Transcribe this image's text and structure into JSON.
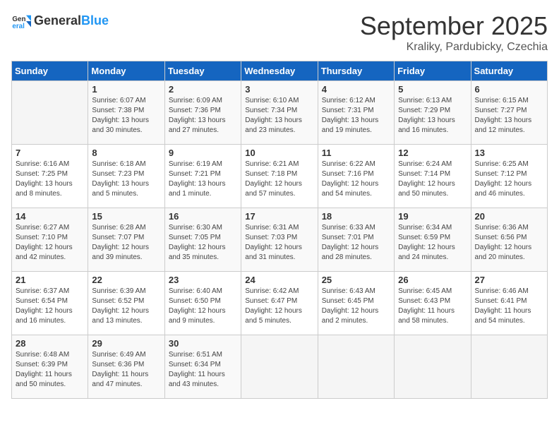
{
  "header": {
    "logo_general": "General",
    "logo_blue": "Blue",
    "month_title": "September 2025",
    "subtitle": "Kraliky, Pardubicky, Czechia"
  },
  "calendar": {
    "days_of_week": [
      "Sunday",
      "Monday",
      "Tuesday",
      "Wednesday",
      "Thursday",
      "Friday",
      "Saturday"
    ],
    "weeks": [
      [
        {
          "day": "",
          "info": ""
        },
        {
          "day": "1",
          "info": "Sunrise: 6:07 AM\nSunset: 7:38 PM\nDaylight: 13 hours\nand 30 minutes."
        },
        {
          "day": "2",
          "info": "Sunrise: 6:09 AM\nSunset: 7:36 PM\nDaylight: 13 hours\nand 27 minutes."
        },
        {
          "day": "3",
          "info": "Sunrise: 6:10 AM\nSunset: 7:34 PM\nDaylight: 13 hours\nand 23 minutes."
        },
        {
          "day": "4",
          "info": "Sunrise: 6:12 AM\nSunset: 7:31 PM\nDaylight: 13 hours\nand 19 minutes."
        },
        {
          "day": "5",
          "info": "Sunrise: 6:13 AM\nSunset: 7:29 PM\nDaylight: 13 hours\nand 16 minutes."
        },
        {
          "day": "6",
          "info": "Sunrise: 6:15 AM\nSunset: 7:27 PM\nDaylight: 13 hours\nand 12 minutes."
        }
      ],
      [
        {
          "day": "7",
          "info": "Sunrise: 6:16 AM\nSunset: 7:25 PM\nDaylight: 13 hours\nand 8 minutes."
        },
        {
          "day": "8",
          "info": "Sunrise: 6:18 AM\nSunset: 7:23 PM\nDaylight: 13 hours\nand 5 minutes."
        },
        {
          "day": "9",
          "info": "Sunrise: 6:19 AM\nSunset: 7:21 PM\nDaylight: 13 hours\nand 1 minute."
        },
        {
          "day": "10",
          "info": "Sunrise: 6:21 AM\nSunset: 7:18 PM\nDaylight: 12 hours\nand 57 minutes."
        },
        {
          "day": "11",
          "info": "Sunrise: 6:22 AM\nSunset: 7:16 PM\nDaylight: 12 hours\nand 54 minutes."
        },
        {
          "day": "12",
          "info": "Sunrise: 6:24 AM\nSunset: 7:14 PM\nDaylight: 12 hours\nand 50 minutes."
        },
        {
          "day": "13",
          "info": "Sunrise: 6:25 AM\nSunset: 7:12 PM\nDaylight: 12 hours\nand 46 minutes."
        }
      ],
      [
        {
          "day": "14",
          "info": "Sunrise: 6:27 AM\nSunset: 7:10 PM\nDaylight: 12 hours\nand 42 minutes."
        },
        {
          "day": "15",
          "info": "Sunrise: 6:28 AM\nSunset: 7:07 PM\nDaylight: 12 hours\nand 39 minutes."
        },
        {
          "day": "16",
          "info": "Sunrise: 6:30 AM\nSunset: 7:05 PM\nDaylight: 12 hours\nand 35 minutes."
        },
        {
          "day": "17",
          "info": "Sunrise: 6:31 AM\nSunset: 7:03 PM\nDaylight: 12 hours\nand 31 minutes."
        },
        {
          "day": "18",
          "info": "Sunrise: 6:33 AM\nSunset: 7:01 PM\nDaylight: 12 hours\nand 28 minutes."
        },
        {
          "day": "19",
          "info": "Sunrise: 6:34 AM\nSunset: 6:59 PM\nDaylight: 12 hours\nand 24 minutes."
        },
        {
          "day": "20",
          "info": "Sunrise: 6:36 AM\nSunset: 6:56 PM\nDaylight: 12 hours\nand 20 minutes."
        }
      ],
      [
        {
          "day": "21",
          "info": "Sunrise: 6:37 AM\nSunset: 6:54 PM\nDaylight: 12 hours\nand 16 minutes."
        },
        {
          "day": "22",
          "info": "Sunrise: 6:39 AM\nSunset: 6:52 PM\nDaylight: 12 hours\nand 13 minutes."
        },
        {
          "day": "23",
          "info": "Sunrise: 6:40 AM\nSunset: 6:50 PM\nDaylight: 12 hours\nand 9 minutes."
        },
        {
          "day": "24",
          "info": "Sunrise: 6:42 AM\nSunset: 6:47 PM\nDaylight: 12 hours\nand 5 minutes."
        },
        {
          "day": "25",
          "info": "Sunrise: 6:43 AM\nSunset: 6:45 PM\nDaylight: 12 hours\nand 2 minutes."
        },
        {
          "day": "26",
          "info": "Sunrise: 6:45 AM\nSunset: 6:43 PM\nDaylight: 11 hours\nand 58 minutes."
        },
        {
          "day": "27",
          "info": "Sunrise: 6:46 AM\nSunset: 6:41 PM\nDaylight: 11 hours\nand 54 minutes."
        }
      ],
      [
        {
          "day": "28",
          "info": "Sunrise: 6:48 AM\nSunset: 6:39 PM\nDaylight: 11 hours\nand 50 minutes."
        },
        {
          "day": "29",
          "info": "Sunrise: 6:49 AM\nSunset: 6:36 PM\nDaylight: 11 hours\nand 47 minutes."
        },
        {
          "day": "30",
          "info": "Sunrise: 6:51 AM\nSunset: 6:34 PM\nDaylight: 11 hours\nand 43 minutes."
        },
        {
          "day": "",
          "info": ""
        },
        {
          "day": "",
          "info": ""
        },
        {
          "day": "",
          "info": ""
        },
        {
          "day": "",
          "info": ""
        }
      ]
    ]
  }
}
